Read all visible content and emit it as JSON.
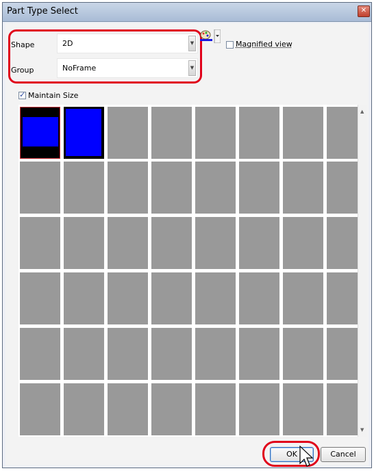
{
  "window": {
    "title": "Part Type Select",
    "close_icon": "close-icon"
  },
  "shape": {
    "label": "Shape",
    "value": "2D"
  },
  "group": {
    "label": "Group",
    "value": "NoFrame"
  },
  "magnified_view": {
    "label": "Magnified view",
    "checked": false
  },
  "maintain_size": {
    "label": "Maintain Size",
    "checked": true
  },
  "grid": {
    "rows": 6,
    "cols": 8,
    "selected_index": 0
  },
  "buttons": {
    "ok": "OK",
    "cancel": "Cancel"
  },
  "colors": {
    "highlight": "#e0001a",
    "part_blue": "#0000ff",
    "empty_cell": "#999999"
  }
}
